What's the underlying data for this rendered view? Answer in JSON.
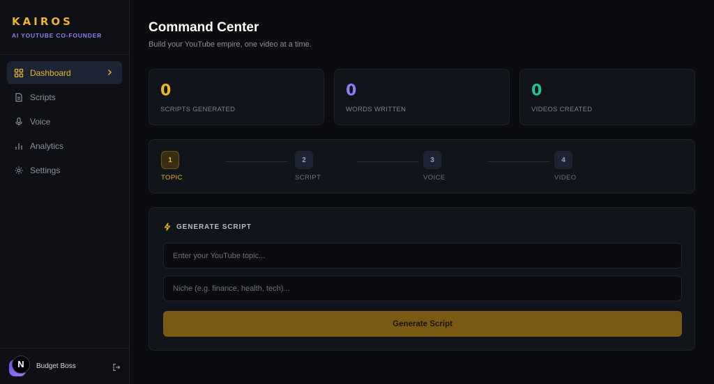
{
  "brand": {
    "name": "KAIROS",
    "subtitle": "AI YOUTUBE CO-FOUNDER"
  },
  "sidebar": {
    "items": [
      {
        "label": "Dashboard",
        "icon": "grid-icon",
        "active": true
      },
      {
        "label": "Scripts",
        "icon": "document-icon"
      },
      {
        "label": "Voice",
        "icon": "microphone-icon"
      },
      {
        "label": "Analytics",
        "icon": "bar-chart-icon"
      },
      {
        "label": "Settings",
        "icon": "gear-icon"
      }
    ]
  },
  "user": {
    "avatar_letter": "N",
    "name": "Budget Boss"
  },
  "header": {
    "title": "Command Center",
    "subtitle": "Build your YouTube empire, one video at a time."
  },
  "stats": [
    {
      "value": "0",
      "label": "SCRIPTS GENERATED",
      "color": "#f0b429"
    },
    {
      "value": "0",
      "label": "WORDS WRITTEN",
      "color": "#8c7ff0"
    },
    {
      "value": "0",
      "label": "VIDEOS CREATED",
      "color": "#22c58b"
    }
  ],
  "steps": [
    {
      "number": "1",
      "label": "TOPIC",
      "active": true
    },
    {
      "number": "2",
      "label": "SCRIPT"
    },
    {
      "number": "3",
      "label": "VOICE"
    },
    {
      "number": "4",
      "label": "VIDEO"
    }
  ],
  "generate": {
    "heading": "GENERATE SCRIPT",
    "topic_placeholder": "Enter your YouTube topic...",
    "topic_value": "",
    "niche_placeholder": "Niche (e.g. finance, health, tech)...",
    "niche_value": "",
    "button_label": "Generate Script"
  },
  "colors": {
    "accent": "#f0b429",
    "purple": "#8c7ff0",
    "green": "#22c58b"
  }
}
